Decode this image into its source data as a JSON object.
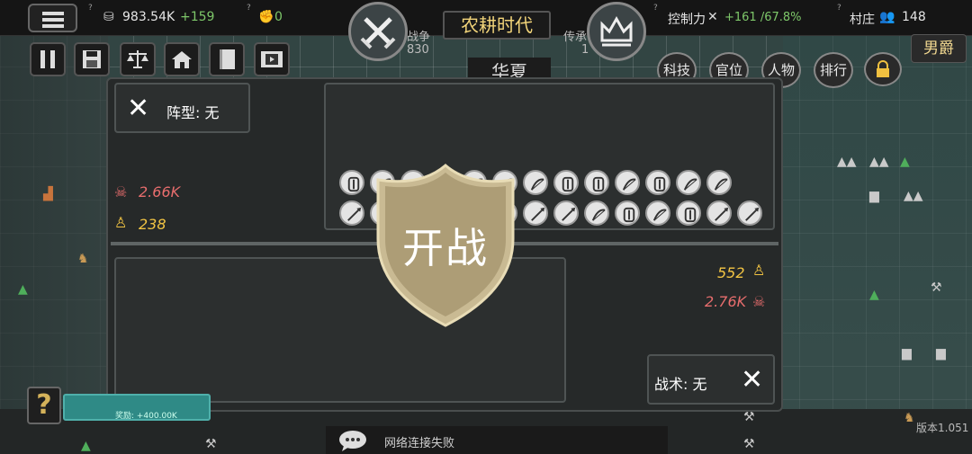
{
  "top_bar": {
    "coins": "983.54K",
    "coins_delta": "+159",
    "strength": "0",
    "war_label": "战争",
    "war_value": "830",
    "age_title": "农耕时代",
    "heritage_label": "传承",
    "heritage_value": "1",
    "control_label": "控制力",
    "control_value": "+161 /67.8%",
    "village_label": "村庄",
    "village_value": "148",
    "rank_label": "男爵"
  },
  "tool_buttons": [
    "pause",
    "save",
    "balance",
    "buildings",
    "book",
    "film"
  ],
  "nav_buttons": [
    "科技",
    "官位",
    "人物",
    "排行"
  ],
  "top_strip_text": "华夏",
  "battle": {
    "formation_label": "阵型: 无",
    "tactic_label": "战术: 无",
    "start_label": "开战",
    "enemy": {
      "deaths": "2.66K",
      "soldiers": "238"
    },
    "own": {
      "soldiers": "552",
      "deaths": "2.76K"
    },
    "enemy_units_row1": [
      "shield",
      "bow",
      "bow",
      "bow",
      "bow",
      "bow",
      "bow",
      "shield",
      "shield",
      "bow",
      "shield",
      "bow",
      "bow"
    ],
    "enemy_units_row2": [
      "spear",
      "bow",
      "bow",
      "bow",
      "bow",
      "bow",
      "spear",
      "spear",
      "bow",
      "shield",
      "bow",
      "shield",
      "spear",
      "spear"
    ]
  },
  "bottom": {
    "progress_text": "奖励: +400.00K",
    "chat_text": "网络连接失败",
    "version": "版本1.051"
  },
  "colors": {
    "gold": "#f3d57a",
    "green": "#7ec86a",
    "red": "#e76d6d",
    "yellow": "#f2c443",
    "shield": "#c9ba93"
  }
}
